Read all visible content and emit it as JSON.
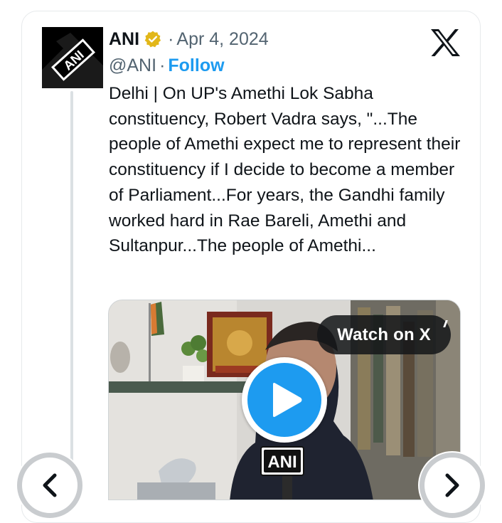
{
  "author": {
    "name": "ANI",
    "handle": "@ANI",
    "verified": true,
    "avatar_text": "ANI"
  },
  "meta": {
    "separator": "·",
    "date": "Apr 4, 2024"
  },
  "actions": {
    "follow_label": "Follow",
    "watch_label": "Watch on X"
  },
  "tweet": {
    "text": "Delhi | On UP's Amethi Lok Sabha constituency, Robert Vadra says, \"...The people of Amethi expect me to represent their constituency if I decide to become a member of Parliament...For years, the Gandhi family worked hard in Rae Bareli, Amethi and Sultanpur...The people of Amethi..."
  },
  "media": {
    "type": "video",
    "mic_logo_text": "ANI"
  },
  "icons": {
    "x_logo": "x-logo-icon",
    "verified": "verified-badge-icon",
    "play": "play-icon",
    "prev": "chevron-left-icon",
    "next": "chevron-right-icon"
  },
  "colors": {
    "follow": "#1d9bf0",
    "play_button": "#1d9bf0",
    "verified_badge": "#e2b719",
    "secondary_text": "#536471"
  }
}
